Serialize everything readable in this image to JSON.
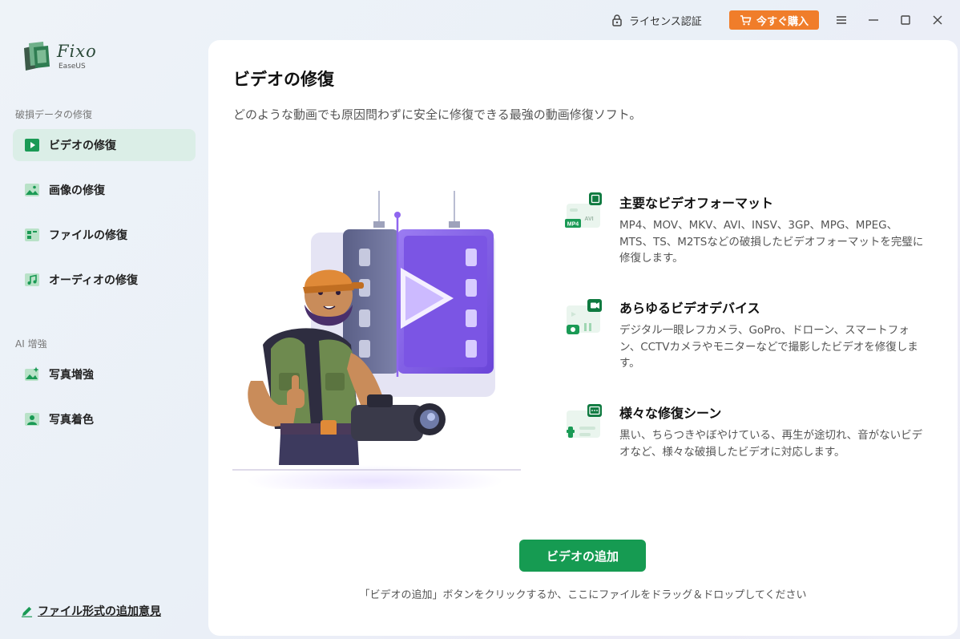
{
  "titlebar": {
    "license_label": "ライセンス認証",
    "buy_label": "今すぐ購入",
    "accent": "#f07d2a"
  },
  "app": {
    "name": "Fixo",
    "brand": "EaseUS"
  },
  "sidebar": {
    "section1_label": "破損データの修復",
    "items": [
      {
        "label": "ビデオの修復",
        "icon": "play-icon",
        "active": true
      },
      {
        "label": "画像の修復",
        "icon": "image-icon",
        "active": false
      },
      {
        "label": "ファイルの修復",
        "icon": "file-icon",
        "active": false
      },
      {
        "label": "オーディオの修復",
        "icon": "music-icon",
        "active": false
      }
    ],
    "section2_label": "AI 增強",
    "ai_items": [
      {
        "label": "写真増強",
        "icon": "sparkle-image-icon"
      },
      {
        "label": "写真着色",
        "icon": "colorize-icon"
      }
    ],
    "feedback_label": "ファイル形式の追加意見",
    "active_bg": "#dbeee7",
    "icon_color": "#1a9a55"
  },
  "main": {
    "title": "ビデオの修復",
    "description": "どのような動画でも原因問わずに安全に修復できる最強の動画修復ソフト。",
    "features": [
      {
        "title": "主要なビデオフォーマット",
        "description": "MP4、MOV、MKV、AVI、INSV、3GP、MPG、MPEG、MTS、TS、M2TSなどの破損したビデオフォーマットを完璧に修復します。",
        "icon": "video-format-icon",
        "badges": [
          "MP4",
          "AVI"
        ]
      },
      {
        "title": "あらゆるビデオデバイス",
        "description": "デジタル一眼レフカメラ、GoPro、ドローン、スマートフォン、CCTVカメラやモニターなどで撮影したビデオを修復します。",
        "icon": "video-device-icon"
      },
      {
        "title": "様々な修復シーン",
        "description": "黒い、ちらつきやぼやけている、再生が途切れ、音がないビデオなど、様々な破損したビデオに対応します。",
        "icon": "repair-scene-icon"
      }
    ],
    "add_button_label": "ビデオの追加",
    "hint": "「ビデオの追加」ボタンをクリックするか、ここにファイルをドラッグ＆ドロップしてください",
    "primary_color": "#169b52"
  }
}
